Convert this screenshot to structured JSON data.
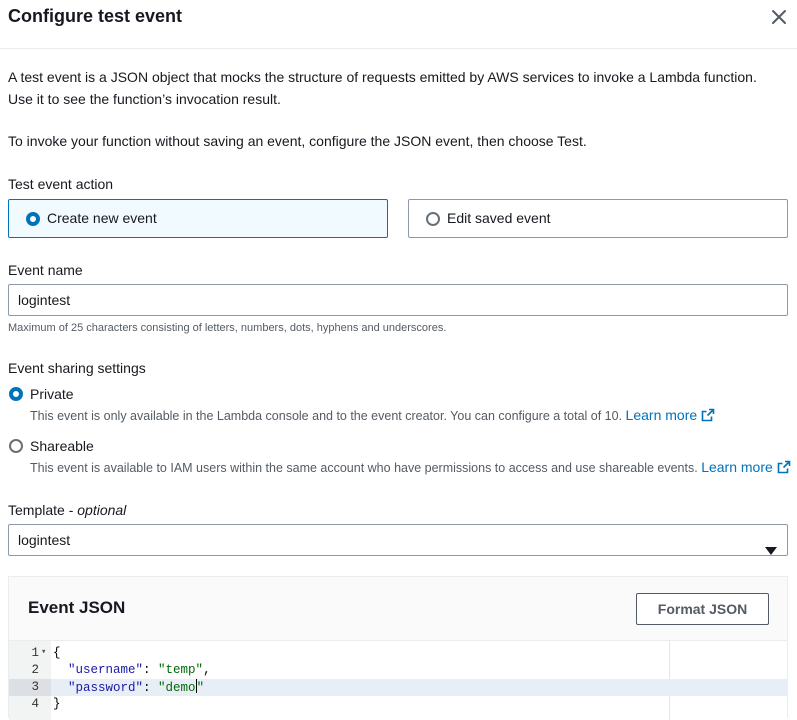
{
  "modal": {
    "title": "Configure test event",
    "close_icon": "close-icon"
  },
  "intro": {
    "line1": "A test event is a JSON object that mocks the structure of requests emitted by AWS services to invoke a Lambda function.",
    "line2": "Use it to see the function’s invocation result.",
    "line3": "To invoke your function without saving an event, configure the JSON event, then choose Test."
  },
  "test_event_action": {
    "label": "Test event action",
    "options": [
      {
        "label": "Create new event",
        "selected": true
      },
      {
        "label": "Edit saved event",
        "selected": false
      }
    ]
  },
  "event_name": {
    "label": "Event name",
    "value": "logintest",
    "hint": "Maximum of 25 characters consisting of letters, numbers, dots, hyphens and underscores."
  },
  "sharing": {
    "label": "Event sharing settings",
    "options": [
      {
        "label": "Private",
        "description": "This event is only available in the Lambda console and to the event creator. You can configure a total of 10.",
        "link": "Learn more",
        "selected": true
      },
      {
        "label": "Shareable",
        "description": "This event is available to IAM users within the same account who have permissions to access and use shareable events.",
        "link": "Learn more",
        "selected": false
      }
    ]
  },
  "template": {
    "label": "Template -",
    "label_optional": "optional",
    "value": "logintest"
  },
  "event_json": {
    "title": "Event JSON",
    "format_button": "Format JSON",
    "lines": [
      {
        "num": "1",
        "open": "{"
      },
      {
        "num": "2",
        "key": "\"username\"",
        "sep": ": ",
        "val": "\"temp\"",
        "end": ","
      },
      {
        "num": "3",
        "key": "\"password\"",
        "sep": ": ",
        "val_a": "\"demo",
        "val_b": "\""
      },
      {
        "num": "4",
        "close": "}"
      }
    ]
  },
  "colors": {
    "accent": "#0073bb",
    "selected_tile_bg": "#f1faff",
    "text": "#16191f",
    "muted": "#545b64"
  }
}
